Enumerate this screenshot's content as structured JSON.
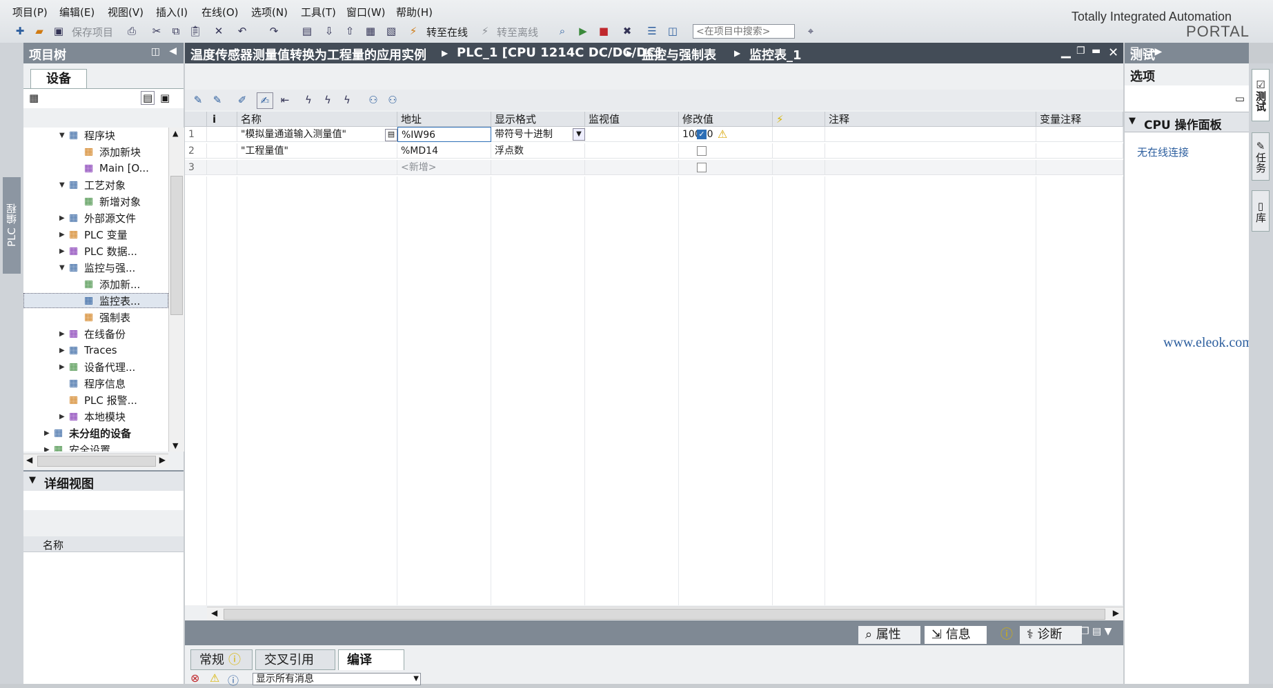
{
  "menu": [
    "项目(P)",
    "编辑(E)",
    "视图(V)",
    "插入(I)",
    "在线(O)",
    "选项(N)",
    "工具(T)",
    "窗口(W)",
    "帮助(H)"
  ],
  "toolbar": {
    "save_project": "保存项目",
    "go_online": "转至在线",
    "go_offline": "转至离线",
    "search_placeholder": "<在项目中搜索>"
  },
  "brand": {
    "line1": "Totally Integrated Automation",
    "line2": "PORTAL"
  },
  "left_vertical_tab": "PLC 编程",
  "project_tree": {
    "title": "项目树",
    "devices_tab": "设备",
    "items": [
      {
        "label": "程序块",
        "indent": 2,
        "expand": "open",
        "icon": "program-blocks-icon"
      },
      {
        "label": "添加新块",
        "indent": 3,
        "expand": "none",
        "icon": "add-block-icon"
      },
      {
        "label": "Main [O...",
        "indent": 3,
        "expand": "none",
        "icon": "main-ob-icon"
      },
      {
        "label": "工艺对象",
        "indent": 2,
        "expand": "open",
        "icon": "technology-objects-icon"
      },
      {
        "label": "新增对象",
        "indent": 3,
        "expand": "none",
        "icon": "add-object-icon"
      },
      {
        "label": "外部源文件",
        "indent": 2,
        "expand": "closed",
        "icon": "external-source-icon"
      },
      {
        "label": "PLC 变量",
        "indent": 2,
        "expand": "closed",
        "icon": "plc-tags-icon"
      },
      {
        "label": "PLC 数据...",
        "indent": 2,
        "expand": "closed",
        "icon": "plc-data-types-icon"
      },
      {
        "label": "监控与强...",
        "indent": 2,
        "expand": "open",
        "icon": "watch-force-tables-icon"
      },
      {
        "label": "添加新...",
        "indent": 3,
        "expand": "none",
        "icon": "add-watch-table-icon"
      },
      {
        "label": "监控表...",
        "indent": 3,
        "expand": "none",
        "icon": "watch-table-icon",
        "selected": true
      },
      {
        "label": "强制表",
        "indent": 3,
        "expand": "none",
        "icon": "force-table-icon"
      },
      {
        "label": "在线备份",
        "indent": 2,
        "expand": "closed",
        "icon": "online-backup-icon"
      },
      {
        "label": "Traces",
        "indent": 2,
        "expand": "closed",
        "icon": "traces-icon"
      },
      {
        "label": "设备代理...",
        "indent": 2,
        "expand": "closed",
        "icon": "device-proxy-icon"
      },
      {
        "label": "程序信息",
        "indent": 2,
        "expand": "none",
        "icon": "program-info-icon"
      },
      {
        "label": "PLC 报警...",
        "indent": 2,
        "expand": "none",
        "icon": "plc-alarms-icon"
      },
      {
        "label": "本地模块",
        "indent": 2,
        "expand": "closed",
        "icon": "local-modules-icon"
      },
      {
        "label": "未分组的设备",
        "indent": 1,
        "expand": "closed",
        "icon": "ungrouped-devices-icon",
        "bold": true
      },
      {
        "label": "安全设置",
        "indent": 1,
        "expand": "closed",
        "icon": "security-settings-icon"
      }
    ]
  },
  "detail_view": {
    "title": "详细视图",
    "column": "名称"
  },
  "breadcrumb": [
    "温度传感器测量值转换为工程量的应用实例",
    "PLC_1 [CPU 1214C DC/DC/DC]",
    "监控与强制表",
    "监控表_1"
  ],
  "watch_table": {
    "columns": [
      "i",
      "名称",
      "地址",
      "显示格式",
      "监视值",
      "修改值",
      "⚡",
      "注释",
      "变量注释"
    ],
    "rows": [
      {
        "num": "1",
        "name": "\"模拟量通道输入测量值\"",
        "address": "%IW96",
        "format": "带符号十进制",
        "monitor": "",
        "modify": "10000",
        "checked": true,
        "warn": true
      },
      {
        "num": "2",
        "name": "\"工程量值\"",
        "address": "%MD14",
        "format": "浮点数",
        "monitor": "",
        "modify": "",
        "checked": false,
        "warn": false
      },
      {
        "num": "3",
        "name": "",
        "address": "<新增>",
        "format": "",
        "monitor": "",
        "modify": "",
        "checked": false,
        "warn": false
      }
    ]
  },
  "inspector": {
    "properties": "属性",
    "info": "信息",
    "diagnostics": "诊断",
    "tabs": [
      "常规",
      "交叉引用",
      "编译"
    ],
    "filter": "显示所有消息"
  },
  "task_card": {
    "title": "测试",
    "options": "选项",
    "cpu_panel": "CPU 操作面板",
    "no_online": "无在线连接",
    "vertical_tabs": [
      "测试",
      "任务",
      "库"
    ]
  },
  "watermark": "www.eleok.com"
}
